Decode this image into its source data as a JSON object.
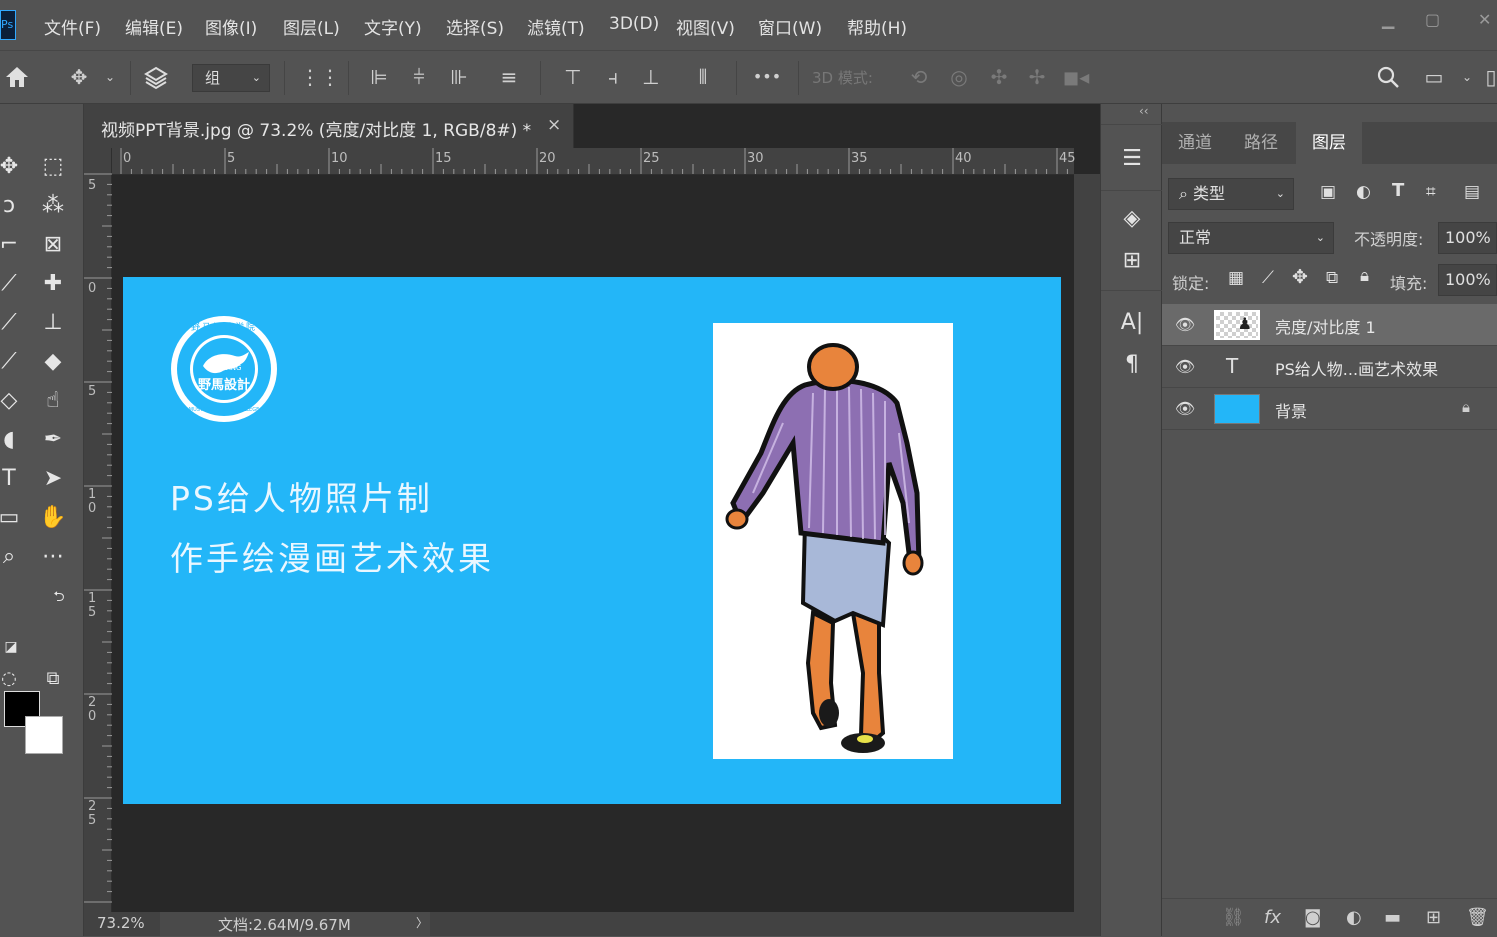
{
  "menubar": {
    "app_logo": "Ps",
    "items": [
      "文件(F)",
      "编辑(E)",
      "图像(I)",
      "图层(L)",
      "文字(Y)",
      "选择(S)",
      "滤镜(T)",
      "3D(D)",
      "视图(V)",
      "窗口(W)",
      "帮助(H)"
    ],
    "window_controls": [
      "minimize-icon",
      "restore-icon",
      "close-icon"
    ]
  },
  "options_bar": {
    "auto_select_target": "组",
    "mode_3d_label": "3D 模式:",
    "more_label": "•••"
  },
  "toolbar": {
    "foreground_color": "#000000",
    "background_color": "#ffffff"
  },
  "document": {
    "tab_title": "视频PPT背景.jpg @ 73.2% (亮度/对比度 1, RGB/8#) *",
    "close_glyph": "×",
    "ruler_top_labels": [
      "0",
      "5",
      "10",
      "15",
      "20",
      "25",
      "30",
      "35",
      "40",
      "45"
    ],
    "ruler_left_labels": [
      "5",
      "0",
      "5",
      "1\n0",
      "1\n5",
      "2\n0",
      "2\n5"
    ],
    "canvas_color": "#23b6f8",
    "heading_line1": "PS给人物照片制",
    "heading_line2": "作手绘漫画艺术效果",
    "logo_text_top": "野马设计学院",
    "logo_text_center": "MUSTANG",
    "logo_text_main": "野馬設計",
    "logo_text_bottom": "MUSTANG DESIGN COLLEGE"
  },
  "statusbar": {
    "zoom": "73.2%",
    "doc_info": "文档:2.64M/9.67M",
    "arrow": "〉"
  },
  "panels": {
    "collapse_glyph": "‹‹",
    "tabs": [
      "通道",
      "路径",
      "图层"
    ],
    "active_tab": "图层",
    "filter_kind": "类型",
    "blend_mode": "正常",
    "opacity_label": "不透明度:",
    "opacity_value": "100%",
    "lock_label": "锁定:",
    "fill_label": "填充:",
    "fill_value": "100%",
    "layers": [
      {
        "name": "亮度/对比度 1",
        "type": "adjustment",
        "visible": true,
        "selected": true
      },
      {
        "name": "PS给人物...画艺术效果",
        "type": "text",
        "visible": true,
        "selected": false
      },
      {
        "name": "背景",
        "type": "image",
        "visible": true,
        "selected": false,
        "locked": true
      }
    ],
    "text_layer_glyph": "T"
  }
}
